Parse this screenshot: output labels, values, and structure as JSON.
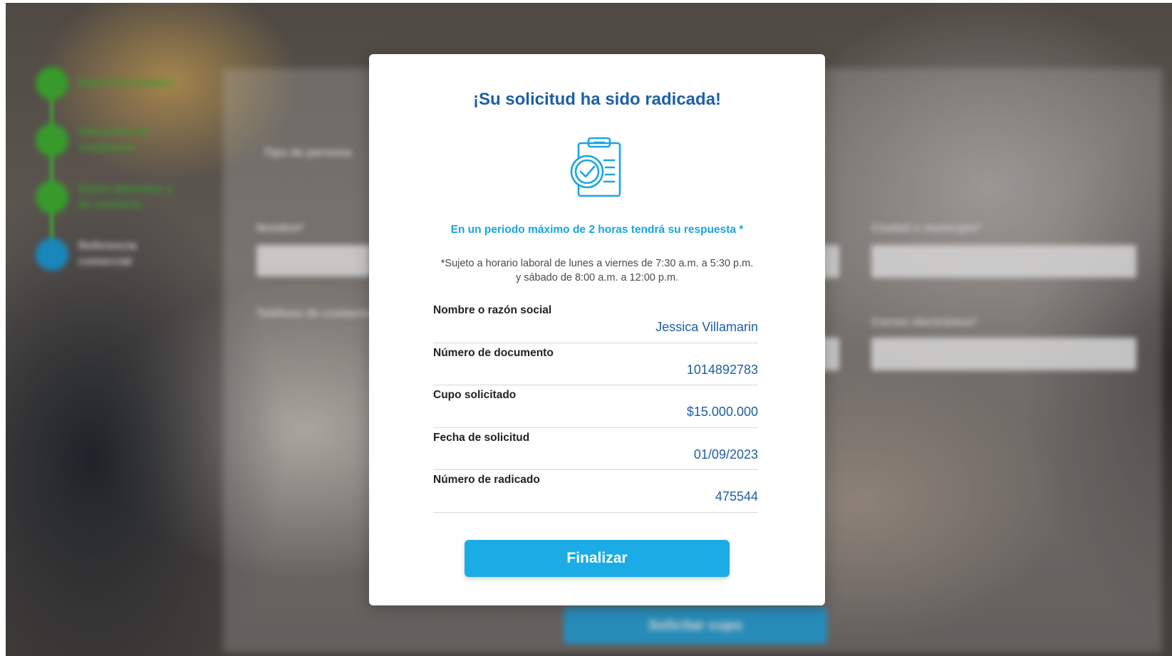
{
  "background": {
    "steps": [
      {
        "label": "Datos Personales",
        "active": false
      },
      {
        "label": "Ubicación de residencia",
        "active": false
      },
      {
        "label": "Datos laborales y de contacto",
        "active": false
      },
      {
        "label": "Referencia comercial",
        "active": true
      }
    ],
    "labels": {
      "person_type": "Tipo de persona",
      "name": "Nombre*",
      "city": "Ciudad o municipio*",
      "phone": "Teléfono de contacto",
      "email": "Correo electrónico*"
    },
    "submit_label": "Solicitar cupo"
  },
  "modal": {
    "title": "¡Su solicitud ha sido radicada!",
    "icon": "clipboard-check-icon",
    "response_note": "En un periodo máximo de 2 horas tendrá su respuesta *",
    "schedule_note_line1": "*Sujeto a horario laboral de lunes a viernes de 7:30 a.m. a 5:30 p.m.",
    "schedule_note_line2": "y sábado de 8:00 a.m. a 12:00 p.m.",
    "fields": [
      {
        "label": "Nombre o razón social",
        "value": "Jessica Villamarin"
      },
      {
        "label": "Número de documento",
        "value": "1014892783"
      },
      {
        "label": "Cupo solicitado",
        "value": "$15.000.000"
      },
      {
        "label": "Fecha de solicitud",
        "value": "01/09/2023"
      },
      {
        "label": "Número de radicado",
        "value": "475544"
      }
    ],
    "finish_label": "Finalizar"
  },
  "colors": {
    "title": "#1d5fa5",
    "accent": "#1bace6",
    "step_done": "#3fb830",
    "step_active": "#1aa0e0"
  }
}
